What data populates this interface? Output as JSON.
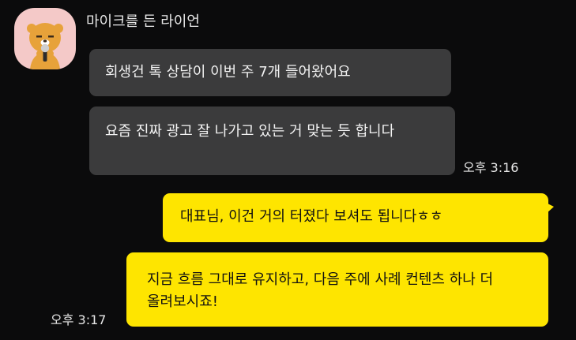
{
  "conversation": {
    "sender": {
      "name": "마이크를 든 라이언",
      "avatar": "lion-holding-microphone-avatar"
    },
    "incoming": [
      {
        "text": "회생건 톡 상담이 이번 주 7개 들어왔어요"
      },
      {
        "text": "요즘 진짜 광고 잘 나가고 있는 거 맞는 듯 합니다"
      }
    ],
    "incoming_time": "오후 3:16",
    "outgoing": [
      {
        "text": "대표님, 이건 거의 터졌다 보셔도 됩니다ㅎㅎ"
      },
      {
        "text": "지금 흐름 그대로 유지하고, 다음 주에 사례 컨텐츠 하나 더 올려보시죠!"
      }
    ],
    "outgoing_time": "오후 3:17"
  },
  "colors": {
    "background": "#0b0b0c",
    "incoming_bubble": "#3b3b3c",
    "outgoing_bubble": "#fee500",
    "avatar_background": "#f4c9c8",
    "lion": "#e7a23a"
  }
}
